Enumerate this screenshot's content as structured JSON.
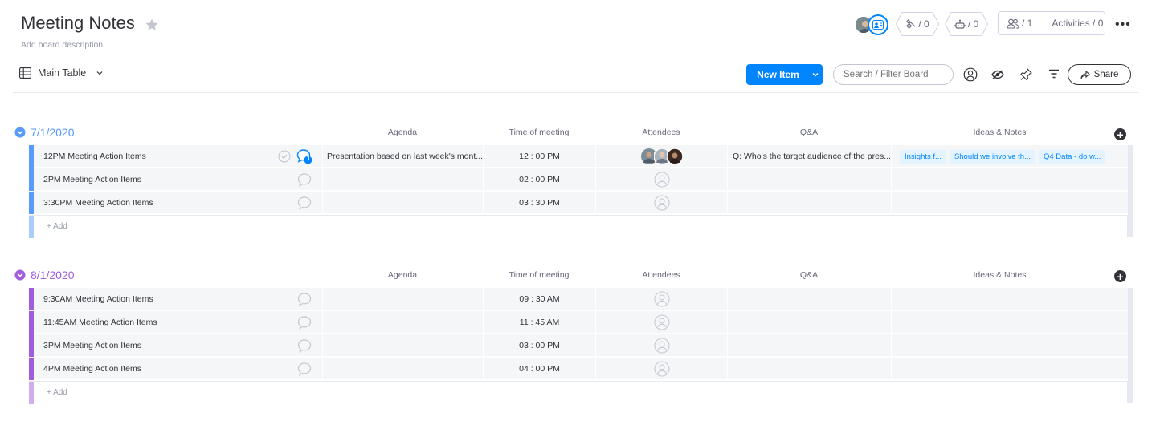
{
  "board": {
    "title": "Meeting Notes",
    "description": "Add board description"
  },
  "header": {
    "integrations_count": "/ 0",
    "automations_count": "/ 0",
    "members_count": "/ 1",
    "activities_label": "Activities / 0"
  },
  "view": {
    "label": "Main Table"
  },
  "toolbar": {
    "new_item_label": "New Item",
    "search_placeholder": "Search / Filter Board",
    "share_label": "Share"
  },
  "columns": [
    "Agenda",
    "Time of meeting",
    "Attendees",
    "Q&A",
    "Ideas & Notes"
  ],
  "add_label": "+ Add",
  "groups": [
    {
      "title": "7/1/2020",
      "color": "#579bfc",
      "items": [
        {
          "name": "12PM Meeting Action Items",
          "agenda": "Presentation based on last week's mont...",
          "time": "12 : 00 PM",
          "qa": "Q: Who's the target audience of the pres...",
          "notes": [
            "Insights f...",
            "Should we involve th...",
            "Q4 Data - do w..."
          ],
          "updates": "1"
        },
        {
          "name": "2PM Meeting Action Items",
          "agenda": "",
          "time": "02 : 00 PM",
          "qa": "",
          "notes": []
        },
        {
          "name": "3:30PM Meeting Action Items",
          "agenda": "",
          "time": "03 : 30 PM",
          "qa": "",
          "notes": []
        }
      ]
    },
    {
      "title": "8/1/2020",
      "color": "#a25ddc",
      "items": [
        {
          "name": "9:30AM Meeting Action Items",
          "agenda": "",
          "time": "09 : 30 AM",
          "qa": "",
          "notes": []
        },
        {
          "name": "11:45AM Meeting Action Items",
          "agenda": "",
          "time": "11 : 45 AM",
          "qa": "",
          "notes": []
        },
        {
          "name": "3PM Meeting Action Items",
          "agenda": "",
          "time": "03 : 00 PM",
          "qa": "",
          "notes": []
        },
        {
          "name": "4PM Meeting Action Items",
          "agenda": "",
          "time": "04 : 00 PM",
          "qa": "",
          "notes": []
        }
      ]
    }
  ]
}
